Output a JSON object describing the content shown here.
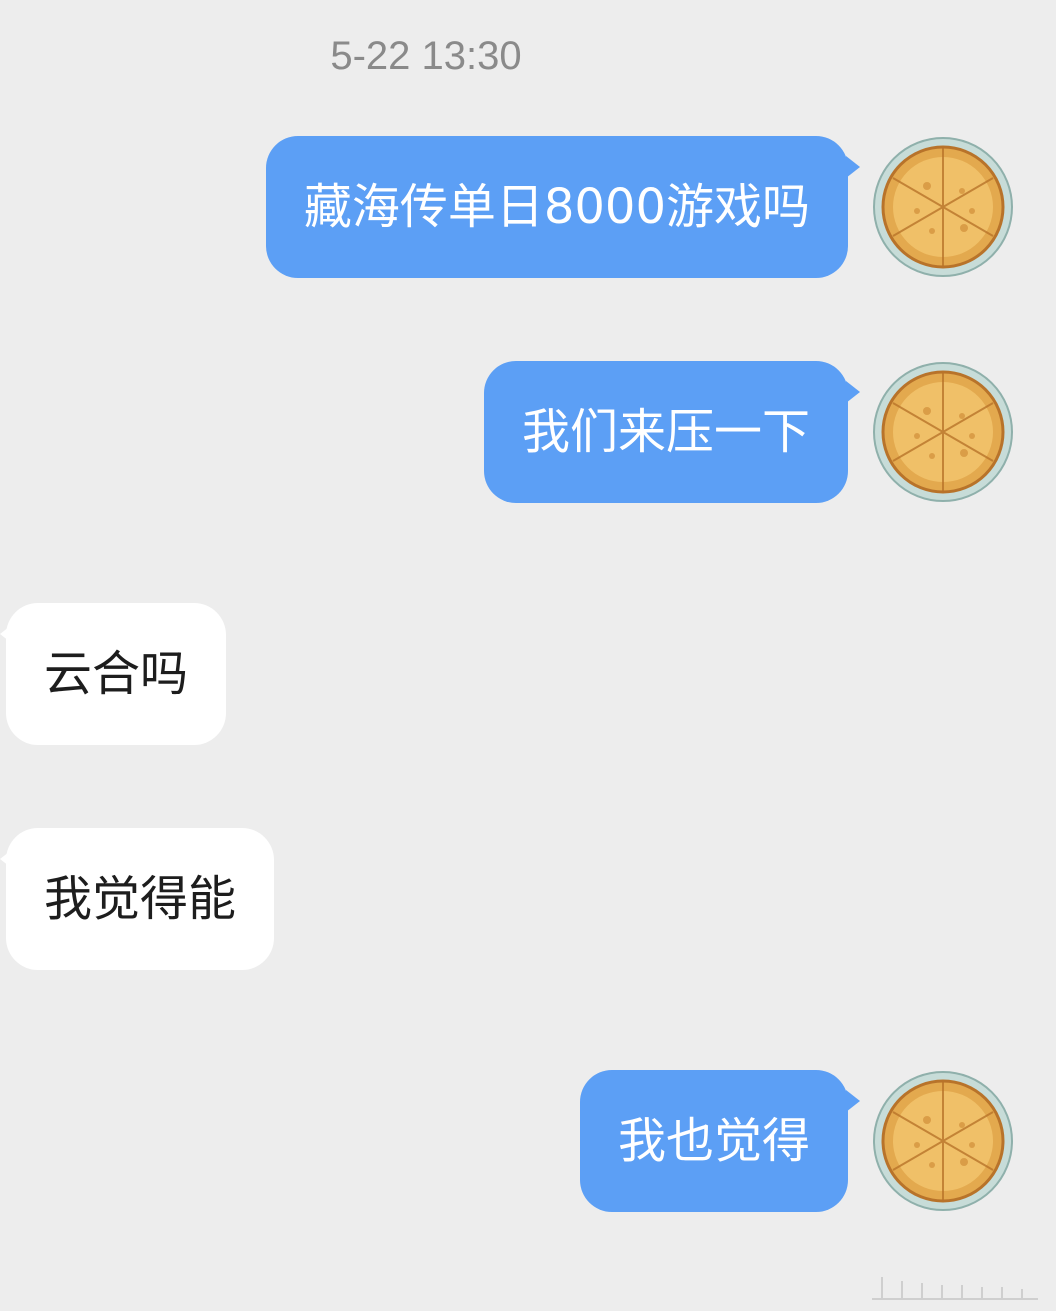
{
  "chat": {
    "timestamp": "5-22 13:30",
    "messages": [
      {
        "direction": "outgoing",
        "text": "藏海传单日8000游戏吗",
        "avatar_icon": "pizza-avatar-icon"
      },
      {
        "direction": "outgoing",
        "text": "我们来压一下",
        "avatar_icon": "pizza-avatar-icon"
      },
      {
        "direction": "incoming",
        "text": "云合吗"
      },
      {
        "direction": "incoming",
        "text": "我觉得能"
      },
      {
        "direction": "outgoing",
        "text": "我也觉得",
        "avatar_icon": "pizza-avatar-icon"
      }
    ]
  },
  "colors": {
    "background": "#ededed",
    "outgoing_bubble": "#5c9ff5",
    "incoming_bubble": "#ffffff",
    "outgoing_text": "#ffffff",
    "incoming_text": "#1d1d1d",
    "timestamp_text": "#8a8a8a"
  }
}
